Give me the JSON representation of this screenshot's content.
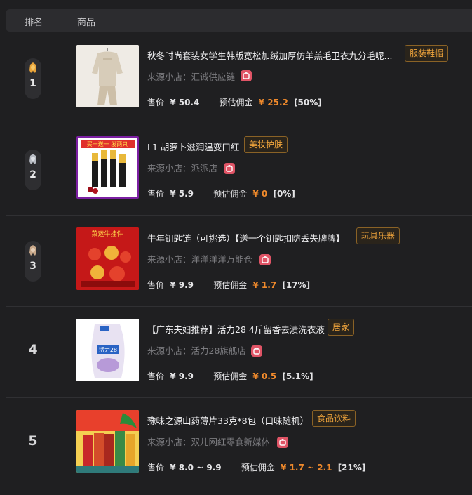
{
  "header": {
    "rank_label": "排名",
    "product_label": "商品"
  },
  "items": [
    {
      "rank": "1",
      "title": "秋冬时尚套装女学生韩版宽松加绒加厚仿羊羔毛卫衣九分毛呢...",
      "tag": "服装鞋帽",
      "shop_label": "来源小店：",
      "shop_name": "汇诚供应链",
      "price_label": "售价",
      "price": "¥ 50.4",
      "commission_label": "预估佣金",
      "commission": "¥ 25.2",
      "rate": "[50%]",
      "medal_color": "#e9a43a"
    },
    {
      "rank": "2",
      "title": "L1 胡萝卜滋润温变口红",
      "tag": "美妆护肤",
      "shop_label": "来源小店：",
      "shop_name": "派派店",
      "price_label": "售价",
      "price": "¥ 5.9",
      "commission_label": "预估佣金",
      "commission": "¥ 0",
      "rate": "[0%]",
      "medal_color": "#b8bcc4",
      "image_text": "买一送一 发两只"
    },
    {
      "rank": "3",
      "title": "牛年钥匙链（可挑选）【送一个钥匙扣防丢失牌牌】",
      "tag": "玩具乐器",
      "shop_label": "来源小店：",
      "shop_name": "洋洋洋洋万能仓",
      "price_label": "售价",
      "price": "¥ 9.9",
      "commission_label": "预估佣金",
      "commission": "¥ 1.7",
      "rate": "[17%]",
      "medal_color": "#c8a88a",
      "image_text": "菜运牛挂件"
    },
    {
      "rank": "4",
      "title": "【广东夫妇推荐】活力28 4斤留香去渍洗衣液",
      "tag": "居家",
      "shop_label": "来源小店：",
      "shop_name": "活力28旗舰店",
      "price_label": "售价",
      "price": "¥ 9.9",
      "commission_label": "预估佣金",
      "commission": "¥ 0.5",
      "rate": "[5.1%]",
      "image_text": "活力28"
    },
    {
      "rank": "5",
      "title": "豫味之源山药薄片33克*8包（口味随机）",
      "tag": "食品饮料",
      "shop_label": "来源小店：",
      "shop_name": "双儿网红零食新媒体",
      "price_label": "售价",
      "price": "¥ 8.0 ~ 9.9",
      "commission_label": "预估佣金",
      "commission": "¥ 1.7 ~ 2.1",
      "rate": "[21%]"
    }
  ],
  "colors": {
    "accent": "#f08a2c",
    "tag_text": "#f0a53c",
    "shop_icon": "#e05466"
  }
}
